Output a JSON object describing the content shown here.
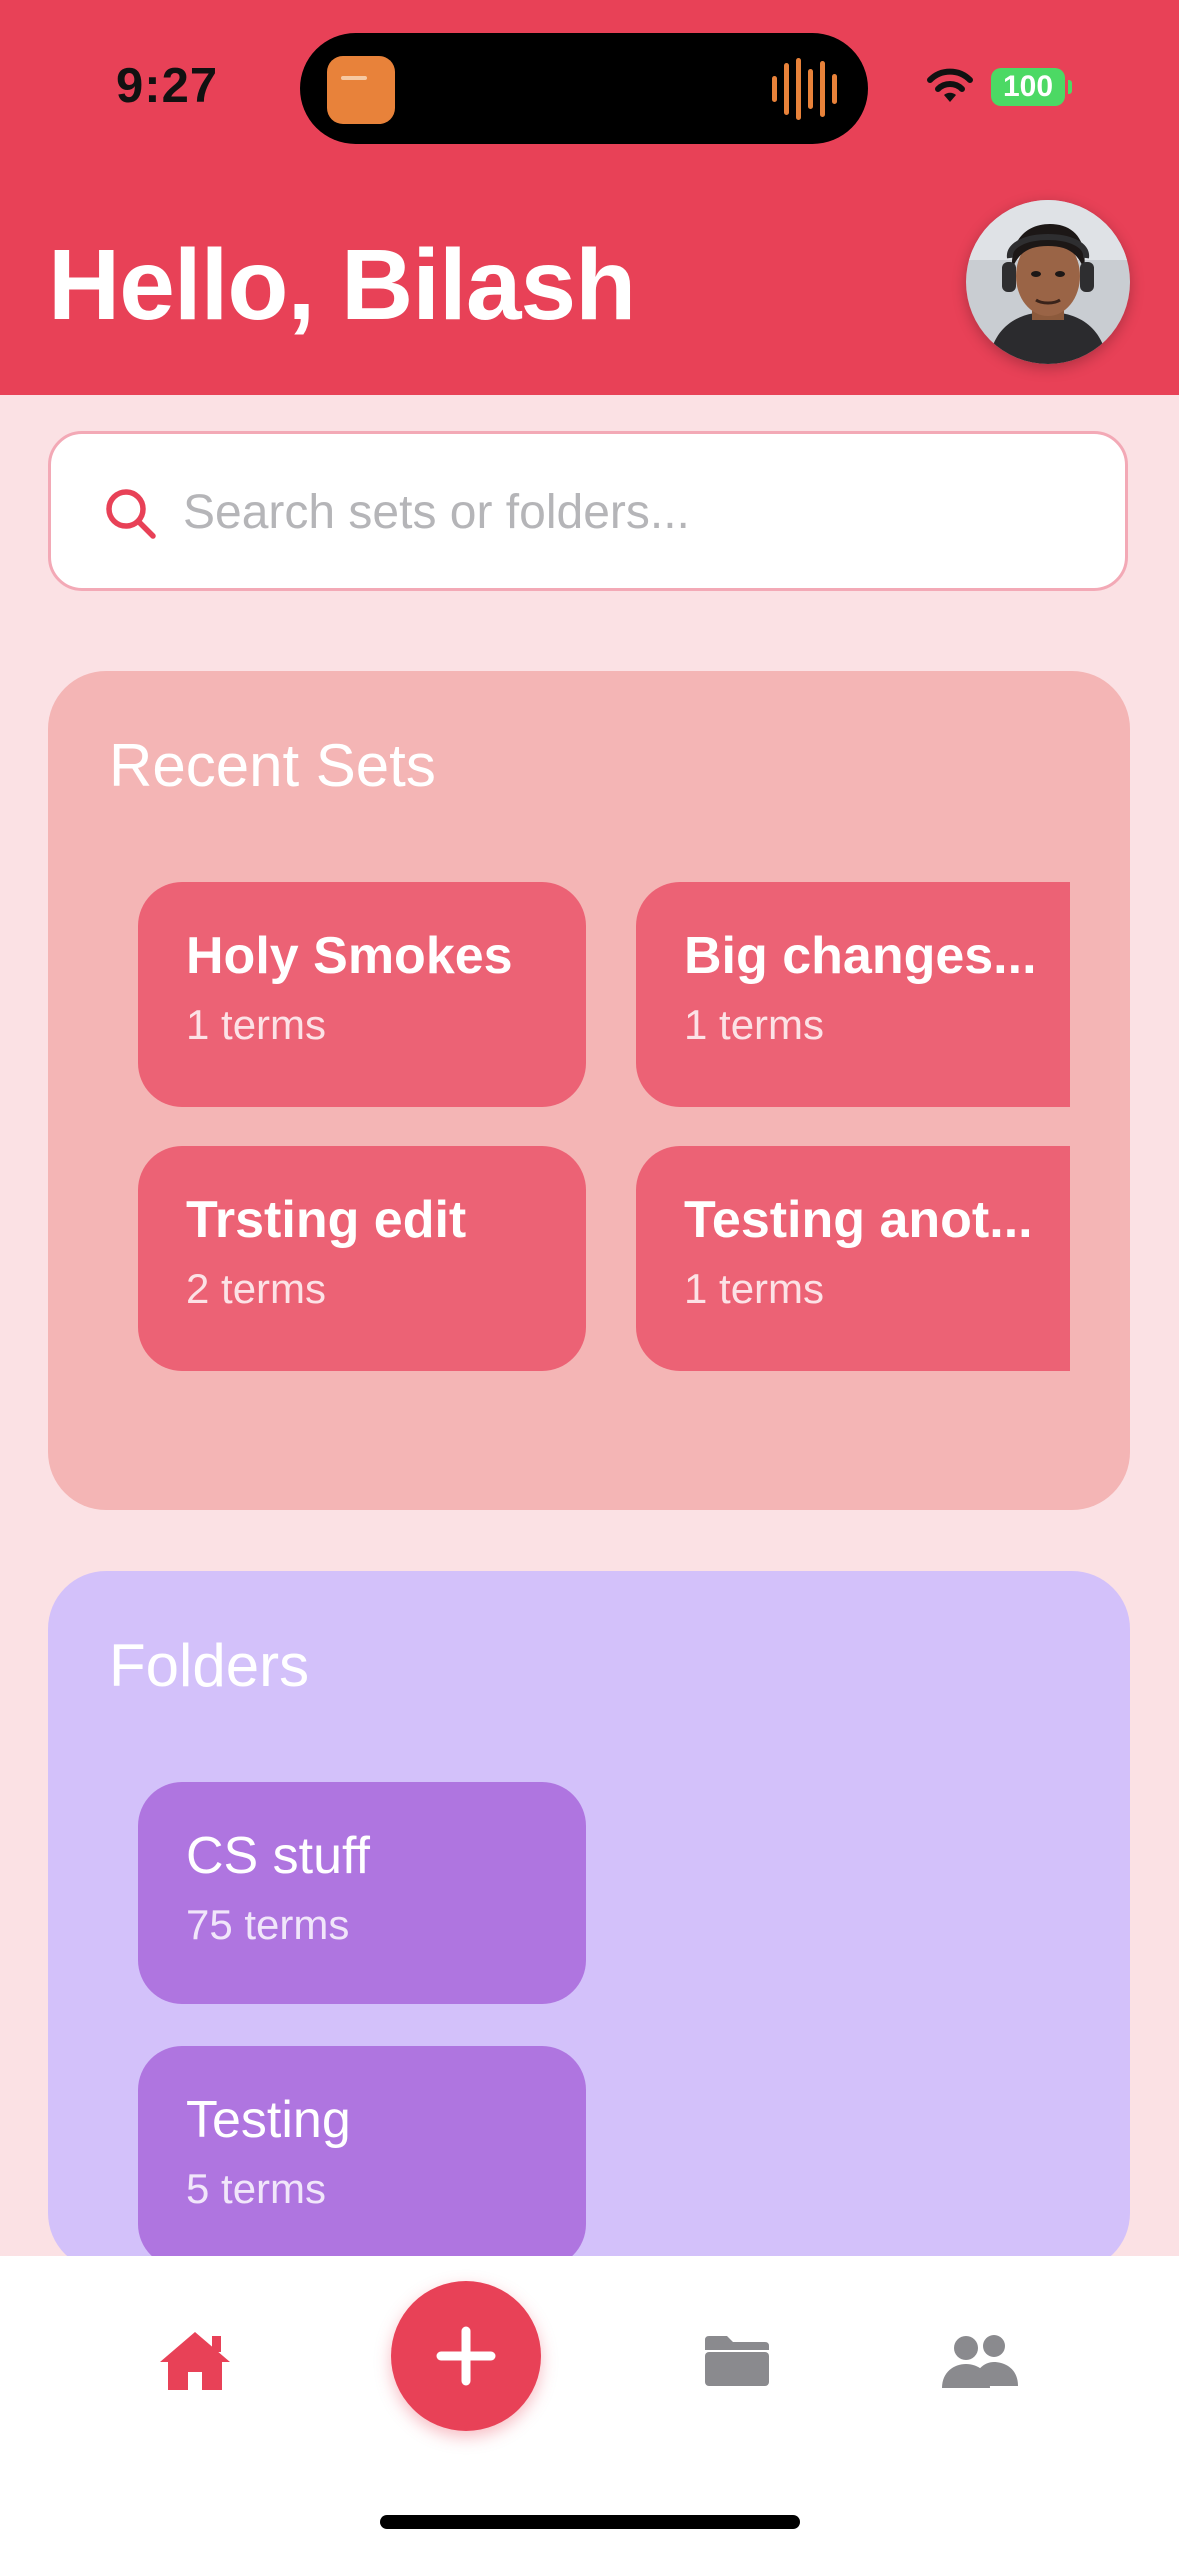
{
  "status_bar": {
    "time": "9:27",
    "battery": "100"
  },
  "header": {
    "greeting": "Hello, Bilash"
  },
  "search": {
    "placeholder": "Search sets or folders..."
  },
  "recent_sets": {
    "title": "Recent Sets",
    "items": [
      {
        "title": "Holy Smokes",
        "subtitle": "1 terms"
      },
      {
        "title": "Big changes...",
        "subtitle": "1 terms"
      },
      {
        "title": "Trsting edit",
        "subtitle": "2 terms"
      },
      {
        "title": "Testing anot...",
        "subtitle": "1 terms"
      }
    ]
  },
  "folders": {
    "title": "Folders",
    "items": [
      {
        "title": "CS stuff",
        "subtitle": "75 terms"
      },
      {
        "title": "Testing",
        "subtitle": "5 terms"
      }
    ]
  },
  "tab_bar": {
    "items": [
      {
        "icon": "home-icon",
        "active": true
      },
      {
        "icon": "plus-icon",
        "active": false
      },
      {
        "icon": "folder-icon",
        "active": false
      },
      {
        "icon": "people-icon",
        "active": false
      }
    ]
  },
  "colors": {
    "accent": "#e84157",
    "page_background": "#fbe1e4",
    "recent_sets_background": "#f4b5b5",
    "set_card": "#ec6275",
    "folders_background": "#d3c1fa",
    "folder_card": "#af75e0",
    "inactive_tab": "#8a8a8e"
  }
}
